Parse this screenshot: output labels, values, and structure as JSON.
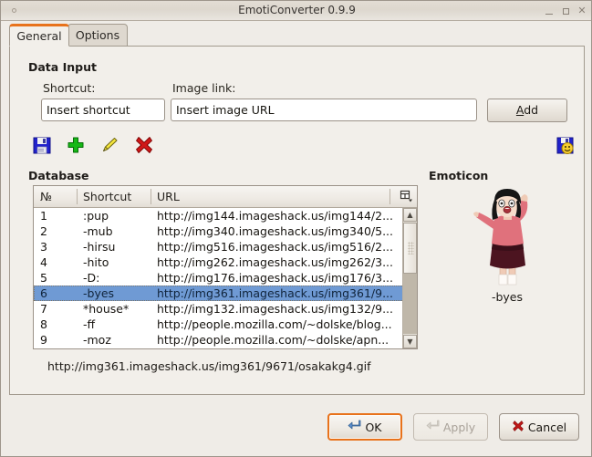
{
  "window": {
    "title": "EmotiConverter 0.9.9",
    "controls": {
      "minimize": "_",
      "maximize": "□",
      "close": "✕"
    }
  },
  "tabs": [
    {
      "label": "General",
      "active": true
    },
    {
      "label": "Options",
      "active": false
    }
  ],
  "data_input": {
    "group_title": "Data Input",
    "shortcut_label": "Shortcut:",
    "shortcut_value": "Insert shortcut",
    "shortcut_placeholder": "Insert shortcut",
    "image_link_label": "Image link:",
    "image_link_value": "Insert image URL",
    "image_link_placeholder": "Insert image URL",
    "add_button": {
      "prefix": "",
      "mnemonic": "A",
      "suffix": "dd"
    }
  },
  "toolbar": {
    "icons": [
      {
        "name": "save-icon",
        "title": "Save"
      },
      {
        "name": "add-icon",
        "title": "Add"
      },
      {
        "name": "edit-icon",
        "title": "Edit"
      },
      {
        "name": "delete-icon",
        "title": "Delete"
      }
    ],
    "save_emoticons": {
      "name": "save-emoticons-icon",
      "title": "Save emoticons"
    }
  },
  "database": {
    "group_title": "Database",
    "columns": [
      "№",
      "Shortcut",
      "URL"
    ],
    "column_chooser_icon": "column-chooser-icon",
    "rows": [
      {
        "num": "1",
        "shortcut": ":pup",
        "url": "http://img144.imageshack.us/img144/2...",
        "selected": false
      },
      {
        "num": "2",
        "shortcut": "-mub",
        "url": "http://img340.imageshack.us/img340/5...",
        "selected": false
      },
      {
        "num": "3",
        "shortcut": "-hirsu",
        "url": "http://img516.imageshack.us/img516/2...",
        "selected": false
      },
      {
        "num": "4",
        "shortcut": "-hito",
        "url": "http://img262.imageshack.us/img262/3...",
        "selected": false
      },
      {
        "num": "5",
        "shortcut": "-D:",
        "url": "http://img176.imageshack.us/img176/3...",
        "selected": false
      },
      {
        "num": "6",
        "shortcut": "-byes",
        "url": "http://img361.imageshack.us/img361/9...",
        "selected": true
      },
      {
        "num": "7",
        "shortcut": "*house*",
        "url": "http://img132.imageshack.us/img132/9...",
        "selected": false
      },
      {
        "num": "8",
        "shortcut": "-ff",
        "url": "http://people.mozilla.com/~dolske/blog...",
        "selected": false
      },
      {
        "num": "9",
        "shortcut": "-moz",
        "url": "http://people.mozilla.com/~dolske/apn...",
        "selected": false
      }
    ],
    "status_url": "http://img361.imageshack.us/img361/9671/osakakg4.gif"
  },
  "emoticon": {
    "group_title": "Emoticon",
    "preview_name": "emoticon-preview-image",
    "caption": "-byes"
  },
  "footer": {
    "ok": "OK",
    "apply": "Apply",
    "cancel": "Cancel"
  },
  "colors": {
    "accent": "#e8721b",
    "selection": "#6f9ad4",
    "window_bg": "#efece7",
    "panel_bg": "#f2efea"
  }
}
